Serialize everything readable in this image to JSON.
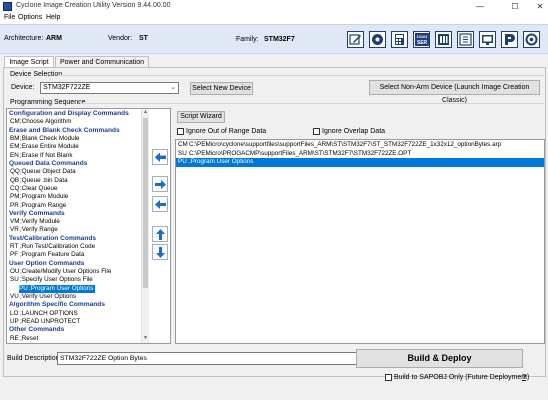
{
  "window": {
    "title": "Cyclone Image Creation Utility  Version 9.44.00.00",
    "minimize": "—",
    "maximize": "☐",
    "close": "✕"
  },
  "menu": [
    "File",
    "Options",
    "Help"
  ],
  "info": {
    "architecture_label": "Architecture:",
    "architecture_value": "ARM",
    "vendor_label": "Vendor:",
    "vendor_value": "ST",
    "family_label": "Family:",
    "family_value": "STM32F7",
    "toolbar_icons": [
      "edit-icon",
      "disc-icon",
      "calculator-icon",
      "ser-icon",
      "book-icon",
      "user-manual-icon",
      "monitor-icon",
      "pemicro-icon"
    ]
  },
  "tabs": [
    "Image Script",
    "Power and Communication"
  ],
  "device_selection": {
    "group_label": "Device Selection",
    "device_label": "Device:",
    "device_value": "STM32F722ZE",
    "select_new_button": "Select New Device",
    "select_non_arm_button": "Select Non-Arm Device (Launch Image Creation Classic)"
  },
  "programming_sequence": {
    "group_label": "Programming Sequence",
    "items": [
      {
        "type": "header",
        "text": "Configuration and Display Commands"
      },
      {
        "type": "cmd",
        "code": "CM",
        "text": ";Choose Algorithm"
      },
      {
        "type": "header",
        "text": "Erase and Blank Check Commands"
      },
      {
        "type": "cmd",
        "code": "BM",
        "text": ";Blank Check Module"
      },
      {
        "type": "cmd",
        "code": "EM",
        "text": ";Erase Entire Module"
      },
      {
        "type": "cmd",
        "code": "EN",
        "text": ";Erase If Not Blank"
      },
      {
        "type": "header",
        "text": "Queued Data Commands"
      },
      {
        "type": "cmd",
        "code": "QQ",
        "text": ";Queue Object Data"
      },
      {
        "type": "cmd",
        "code": "QB",
        "text": ";Queue .bin Data"
      },
      {
        "type": "cmd",
        "code": "CQ",
        "text": ";Clear Queue"
      },
      {
        "type": "cmd",
        "code": "PM",
        "text": ";Program Module"
      },
      {
        "type": "cmd",
        "code": "PR",
        "text": ";Program Range"
      },
      {
        "type": "header",
        "text": "Verify Commands"
      },
      {
        "type": "cmd",
        "code": "VM",
        "text": ";Verify Module"
      },
      {
        "type": "cmd",
        "code": "VR",
        "text": ";Verify Range"
      },
      {
        "type": "header",
        "text": "Test/Calibration Commands"
      },
      {
        "type": "cmd",
        "code": "RT",
        "text": ";Run Test/Calibration Code"
      },
      {
        "type": "cmd",
        "code": "PF",
        "text": ";Program Feature Data"
      },
      {
        "type": "header",
        "text": "User Option Commands"
      },
      {
        "type": "cmd",
        "code": "OU",
        "text": ";Create/Modify User Options File"
      },
      {
        "type": "cmd",
        "code": "SU",
        "text": ";Specify User Options File"
      },
      {
        "type": "cmd",
        "code": "PU",
        "text": ";Program User Options",
        "selected": true
      },
      {
        "type": "cmd",
        "code": "VU",
        "text": ";Verify User Options"
      },
      {
        "type": "header",
        "text": "Algorithm Specific Commands"
      },
      {
        "type": "cmd",
        "code": "LO",
        "text": ";LAUNCH OPTIONS"
      },
      {
        "type": "cmd",
        "code": "UP",
        "text": ";READ UNPROTECT"
      },
      {
        "type": "header",
        "text": "Other Commands"
      },
      {
        "type": "cmd",
        "code": "RE",
        "text": ";Reset"
      }
    ]
  },
  "script": {
    "wizard_button": "Script Wizard",
    "ignore_out_of_range": "Ignore Out of Range Data",
    "ignore_overlap": "Ignore Overlap Data",
    "lines": [
      {
        "code": "CM",
        "text": "C:\\PEMicro\\cyclone\\supportfiles\\supportFiles_ARM\\ST\\STM32F7\\ST_STM32F722ZE_1x32x12_optionBytes.arp",
        "selected": false
      },
      {
        "code": "SU",
        "text": "C:\\PEMicro\\PROGACMP\\supportFiles_ARM\\ST\\STM32F7\\STM32F722ZE.OPT",
        "selected": false
      },
      {
        "code": "PU",
        "text": ";Program User Options",
        "selected": true
      }
    ]
  },
  "bottom": {
    "build_description_label": "Build Description",
    "build_description_value": "STM32F722ZE Option Bytes",
    "build_deploy_button": "Build & Deploy",
    "sapobj_label": "Build to SAPOBJ Only (Future Deployment)",
    "help": "?"
  }
}
